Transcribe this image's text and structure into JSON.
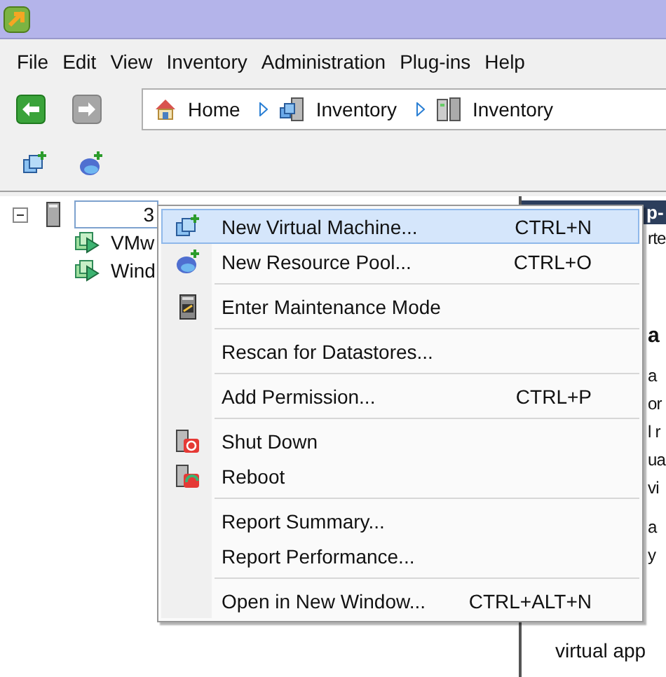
{
  "menu_bar": [
    "File",
    "Edit",
    "View",
    "Inventory",
    "Administration",
    "Plug-ins",
    "Help"
  ],
  "nav": {
    "back": {
      "disabled": false
    },
    "forward": {
      "disabled": true
    }
  },
  "breadcrumb": [
    {
      "kind": "home",
      "label": "Home"
    },
    {
      "kind": "inventory",
      "label": "Inventory"
    },
    {
      "kind": "hosts",
      "label": "Inventory"
    }
  ],
  "tree": {
    "label": "3",
    "selected": true,
    "expanded": true,
    "children": [
      {
        "label": "VMw"
      },
      {
        "label": "Wind"
      }
    ]
  },
  "right_panel": {
    "header": "p-",
    "subtitle": "rte",
    "heading": "a",
    "paragraphs": [
      [
        "a",
        "or",
        "l r",
        "ua",
        "vi"
      ],
      [
        "a",
        "y"
      ]
    ],
    "tail": "virtual app"
  },
  "context_menu": [
    {
      "kind": "item",
      "label": "New Virtual Machine...",
      "shortcut": "CTRL+N",
      "selected": true
    },
    {
      "kind": "item",
      "label": "New Resource Pool...",
      "shortcut": "CTRL+O",
      "selected": false
    },
    {
      "kind": "separator"
    },
    {
      "kind": "item",
      "label": "Enter Maintenance Mode",
      "selected": false
    },
    {
      "kind": "separator"
    },
    {
      "kind": "item",
      "label": "Rescan for Datastores...",
      "selected": false
    },
    {
      "kind": "separator"
    },
    {
      "kind": "item",
      "label": "Add Permission...",
      "shortcut": "CTRL+P",
      "selected": false
    },
    {
      "kind": "separator"
    },
    {
      "kind": "item",
      "label": "Shut Down",
      "selected": false
    },
    {
      "kind": "item",
      "label": "Reboot",
      "selected": false
    },
    {
      "kind": "separator"
    },
    {
      "kind": "item",
      "label": "Report Summary...",
      "selected": false
    },
    {
      "kind": "item",
      "label": "Report Performance...",
      "selected": false
    },
    {
      "kind": "separator"
    },
    {
      "kind": "item",
      "label": "Open in New Window...",
      "shortcut": "CTRL+ALT+N",
      "selected": false
    }
  ]
}
